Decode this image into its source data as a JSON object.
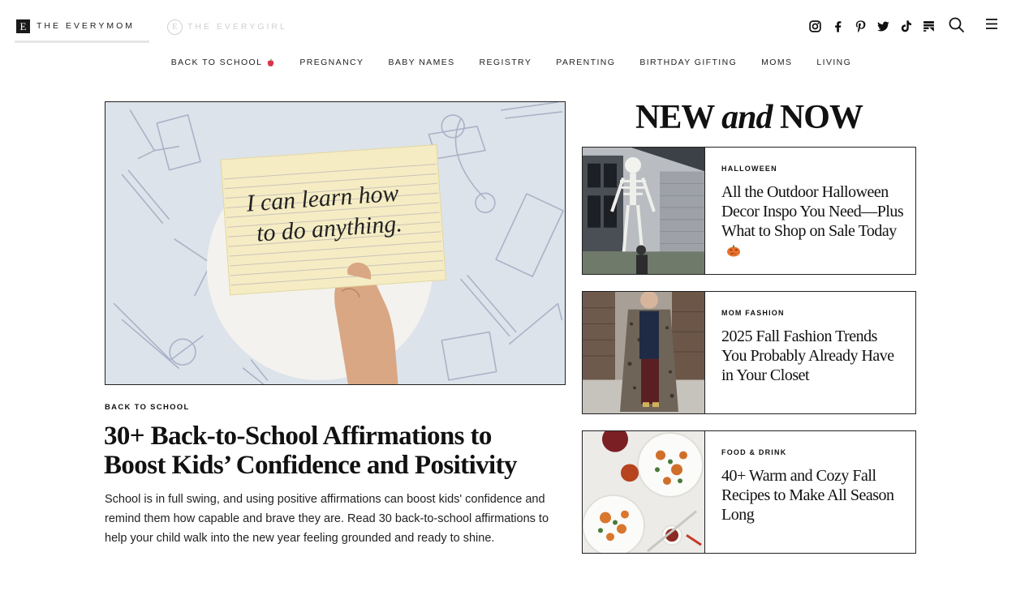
{
  "brands": {
    "active": {
      "logo_letter": "E",
      "name": "THE EVERYMOM"
    },
    "inactive": {
      "logo_letter": "E",
      "name": "THE EVERYGIRL"
    }
  },
  "social_icons": [
    "instagram-icon",
    "facebook-icon",
    "pinterest-icon",
    "twitter-icon",
    "tiktok-icon",
    "flipboard-icon"
  ],
  "nav": {
    "items": [
      {
        "label": "BACK TO SCHOOL",
        "emoji": "apple"
      },
      {
        "label": "PREGNANCY"
      },
      {
        "label": "BABY NAMES"
      },
      {
        "label": "REGISTRY"
      },
      {
        "label": "PARENTING"
      },
      {
        "label": "BIRTHDAY GIFTING"
      },
      {
        "label": "MOMS"
      },
      {
        "label": "LIVING"
      }
    ]
  },
  "hero": {
    "category": "BACK TO SCHOOL",
    "title": "30+ Back-to-School Affirmations to Boost Kids’ Confidence and Positivity",
    "excerpt": "School is in full swing, and using positive affirmations can boost kids' confidence and remind them how capable and brave they are. Read 30 back-to-school affirmations to help your child walk into the new year feeling grounded and ready to shine.",
    "image_card_line1": "I can learn how",
    "image_card_line2": "to do anything."
  },
  "new_and_now": {
    "heading_part1": "NEW",
    "heading_part2": "and",
    "heading_part3": "NOW",
    "cards": [
      {
        "category": "HALLOWEEN",
        "title": "All the Outdoor Halloween Decor Inspo You Need—Plus What to Shop on Sale Today",
        "emoji": "jack-o-lantern"
      },
      {
        "category": "MOM FASHION",
        "title": "2025 Fall Fashion Trends You Probably Already Have in Your Closet"
      },
      {
        "category": "FOOD & DRINK",
        "title": "40+ Warm and Cozy Fall Recipes to Make All Season Long"
      }
    ]
  },
  "colors": {
    "text": "#111111",
    "border": "#222222",
    "hero_bg": "#dde3ea",
    "card_paper": "#f5ecc4"
  }
}
